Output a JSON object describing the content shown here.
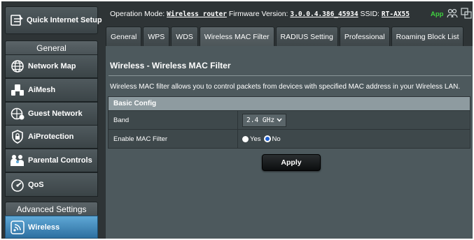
{
  "sidebar": {
    "quick_setup": "Quick Internet Setup",
    "general_header": "General",
    "items": [
      {
        "label": "Network Map",
        "icon": "globe-icon"
      },
      {
        "label": "AiMesh",
        "icon": "aimesh-icon"
      },
      {
        "label": "Guest Network",
        "icon": "guest-network-icon"
      },
      {
        "label": "AiProtection",
        "icon": "lock-shield-icon"
      },
      {
        "label": "Parental Controls",
        "icon": "family-icon"
      },
      {
        "label": "QoS",
        "icon": "speedometer-icon"
      }
    ],
    "advanced_header": "Advanced Settings",
    "wireless_label": "Wireless"
  },
  "topbar": {
    "operation_mode_label": "Operation Mode:",
    "operation_mode": "Wireless router",
    "firmware_label": "Firmware Version:",
    "firmware": "3.0.0.4.386_45934",
    "ssid_label": "SSID:",
    "ssid": "RT-AX55",
    "app_label": "App"
  },
  "tabs": [
    "General",
    "WPS",
    "WDS",
    "Wireless MAC Filter",
    "RADIUS Setting",
    "Professional",
    "Roaming Block List"
  ],
  "active_tab": "Wireless MAC Filter",
  "main": {
    "title": "Wireless - Wireless MAC Filter",
    "description": "Wireless MAC filter allows you to control packets from devices with specified MAC address in your Wireless LAN.",
    "section_header": "Basic Config",
    "band_label": "Band",
    "band_value": "2.4 GHz",
    "mac_filter_label": "Enable MAC Filter",
    "option_yes": "Yes",
    "option_no": "No",
    "selected_option": "No",
    "apply_label": "Apply"
  },
  "colors": {
    "background": "#2e3436",
    "panel": "#4d595d",
    "active_nav": "#3f8cc4",
    "app_green": "#40d040",
    "radio_selected": "#1e5fd0"
  }
}
